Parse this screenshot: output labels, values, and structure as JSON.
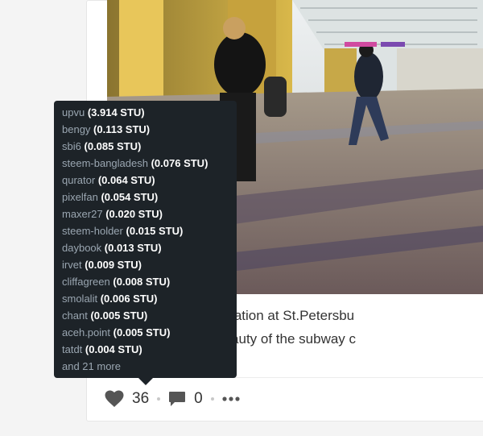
{
  "post": {
    "caption_line1": "l today at the Tube station at St.Petersbu",
    "caption_line2": "d I capture all the beauty of the subway c"
  },
  "actions": {
    "vote_count": "36",
    "comment_count": "0",
    "more_label": "•••"
  },
  "voters": [
    {
      "name": "upvu",
      "amount": "(3.914 STU)"
    },
    {
      "name": "bengy",
      "amount": "(0.113 STU)"
    },
    {
      "name": "sbi6",
      "amount": "(0.085 STU)"
    },
    {
      "name": "steem-bangladesh",
      "amount": "(0.076 STU)"
    },
    {
      "name": "qurator",
      "amount": "(0.064 STU)"
    },
    {
      "name": "pixelfan",
      "amount": "(0.054 STU)"
    },
    {
      "name": "maxer27",
      "amount": "(0.020 STU)"
    },
    {
      "name": "steem-holder",
      "amount": "(0.015 STU)"
    },
    {
      "name": "daybook",
      "amount": "(0.013 STU)"
    },
    {
      "name": "irvet",
      "amount": "(0.009 STU)"
    },
    {
      "name": "cliffagreen",
      "amount": "(0.008 STU)"
    },
    {
      "name": "smolalit",
      "amount": "(0.006 STU)"
    },
    {
      "name": "chant",
      "amount": "(0.005 STU)"
    },
    {
      "name": "aceh.point",
      "amount": "(0.005 STU)"
    },
    {
      "name": "tatdt",
      "amount": "(0.004 STU)"
    }
  ],
  "voters_more": "and 21 more",
  "colors": {
    "tooltip_bg": "#1d2328",
    "voter_name": "#9aa6b1",
    "voter_amount": "#ffffff",
    "icon": "#555555"
  }
}
